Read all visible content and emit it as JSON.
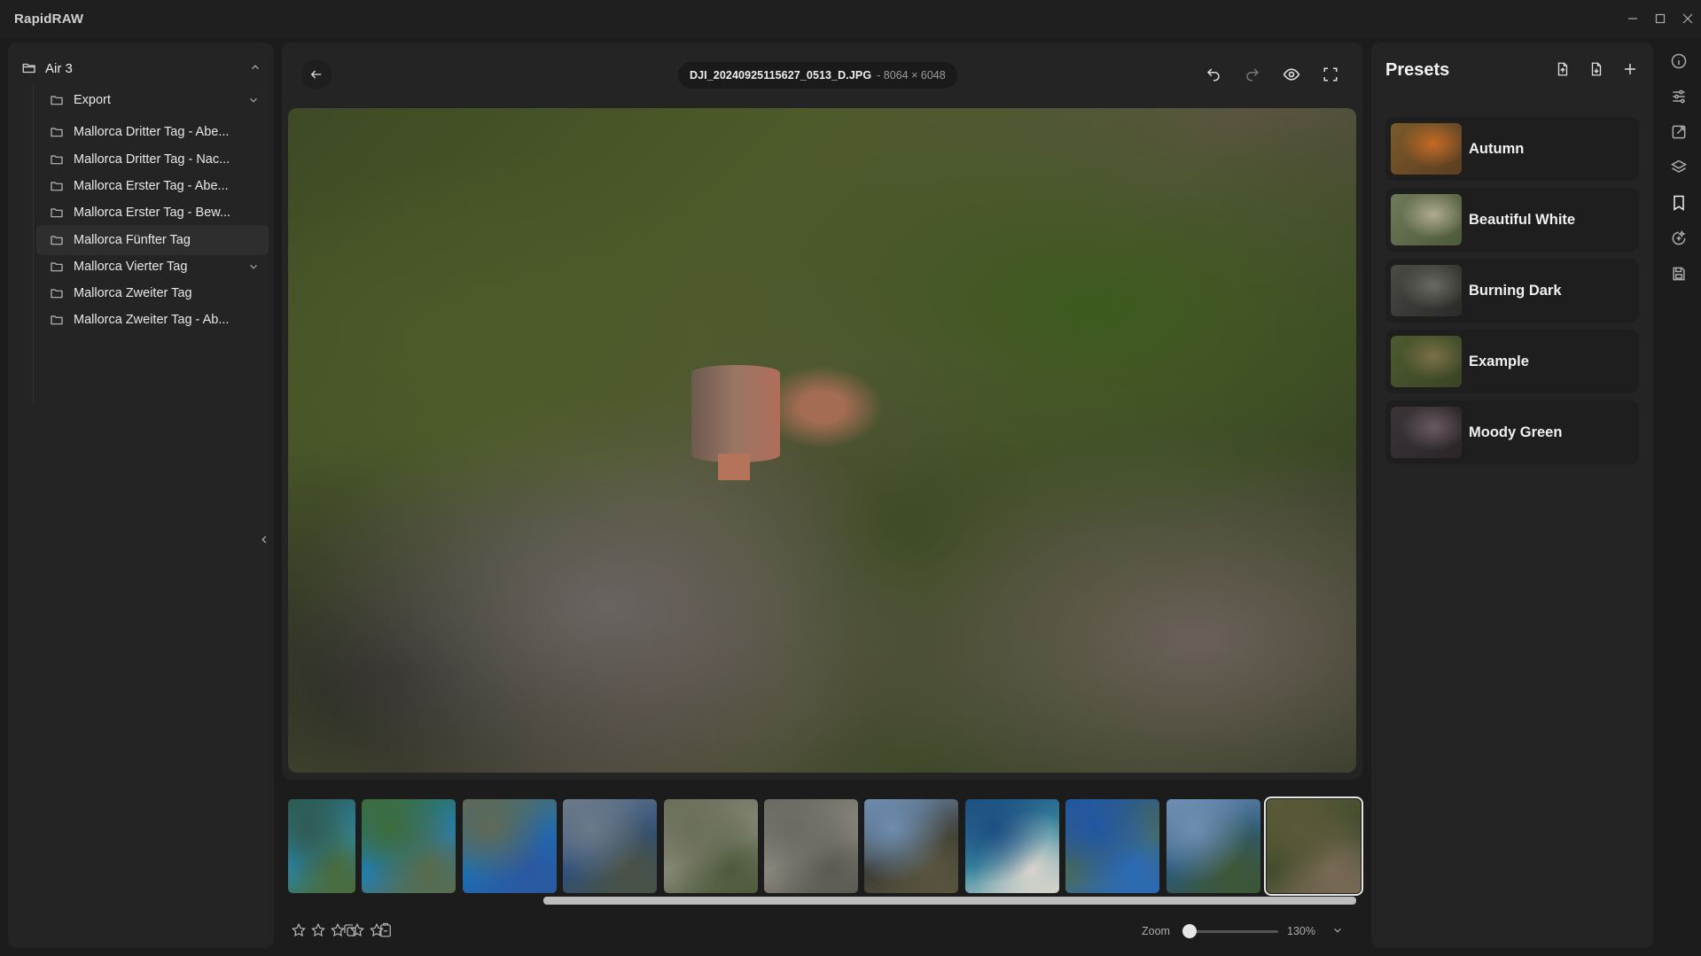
{
  "window": {
    "title": "RapidRAW"
  },
  "folders": {
    "root": "Air 3",
    "items": [
      {
        "label": "Export",
        "expandable": true,
        "active": false
      },
      {
        "label": "Mallorca Dritter Tag - Abe...",
        "expandable": false,
        "active": false
      },
      {
        "label": "Mallorca Dritter Tag - Nac...",
        "expandable": false,
        "active": false
      },
      {
        "label": "Mallorca Erster Tag - Abe...",
        "expandable": false,
        "active": false
      },
      {
        "label": "Mallorca Erster Tag - Bew...",
        "expandable": false,
        "active": false
      },
      {
        "label": "Mallorca Fünfter Tag",
        "expandable": false,
        "active": true
      },
      {
        "label": "Mallorca Vierter Tag",
        "expandable": true,
        "active": false
      },
      {
        "label": "Mallorca Zweiter Tag",
        "expandable": false,
        "active": false
      },
      {
        "label": "Mallorca Zweiter Tag - Ab...",
        "expandable": false,
        "active": false
      }
    ]
  },
  "viewer": {
    "filename": "DJI_20240925115627_0513_D.JPG",
    "dimensions": "- 8064 × 6048",
    "tools": [
      "undo-icon",
      "redo-icon",
      "eye-icon",
      "fullscreen-icon"
    ]
  },
  "filmstrip": {
    "thumbnails": [
      {
        "colors": [
          "#2f5a52",
          "#2a86a8",
          "#4b6a3a"
        ]
      },
      {
        "colors": [
          "#3d6b3a",
          "#1f7fb8",
          "#5a6b4a"
        ]
      },
      {
        "colors": [
          "#5f6a55",
          "#1d6fb2",
          "#2b58a0"
        ]
      },
      {
        "colors": [
          "#6c7a8a",
          "#2c4f7a",
          "#4a5244"
        ]
      },
      {
        "colors": [
          "#6a6f5a",
          "#8a8a7a",
          "#4d5a3a"
        ]
      },
      {
        "colors": [
          "#6b6a62",
          "#8d8a80",
          "#5a5a52"
        ]
      },
      {
        "colors": [
          "#6e8db0",
          "#3b3c34",
          "#58543e"
        ]
      },
      {
        "colors": [
          "#1d4f82",
          "#3a8aa0",
          "#d8d4cc"
        ]
      },
      {
        "colors": [
          "#2156a3",
          "#4b6a54",
          "#2a6ab8"
        ]
      },
      {
        "colors": [
          "#6f8eb2",
          "#2b5a7a",
          "#3d5634"
        ]
      },
      {
        "colors": [
          "#5a5a38",
          "#3e4a2a",
          "#7a6a55"
        ]
      }
    ],
    "selected_index": 10,
    "scroll_fraction": 0.24
  },
  "bottombar": {
    "rating": 0,
    "max_rating": 5,
    "zoom_label": "Zoom",
    "zoom_value": "130%",
    "zoom_fraction": 0.0
  },
  "presets": {
    "title": "Presets",
    "actions": [
      "import-preset-icon",
      "export-preset-icon",
      "add-preset-icon"
    ],
    "items": [
      {
        "name": "Autumn",
        "colors": [
          "#7a5b2a",
          "#c46a24",
          "#5c3d22"
        ]
      },
      {
        "name": "Beautiful White",
        "colors": [
          "#6e7a5a",
          "#b0aa90",
          "#4d5a3a"
        ]
      },
      {
        "name": "Burning Dark",
        "colors": [
          "#4a4a46",
          "#6a6a62",
          "#2a2a28"
        ]
      },
      {
        "name": "Example",
        "colors": [
          "#4d5a2e",
          "#7a7048",
          "#3a4424"
        ]
      },
      {
        "name": "Moody Green",
        "colors": [
          "#3a3438",
          "#6a5a62",
          "#2a2628"
        ]
      }
    ]
  },
  "rail": {
    "icons": [
      "info-icon",
      "adjustments-icon",
      "crop-icon",
      "layers-icon",
      "presets-bookmark-icon",
      "ai-icon",
      "export-icon"
    ],
    "active": "presets-bookmark-icon"
  }
}
